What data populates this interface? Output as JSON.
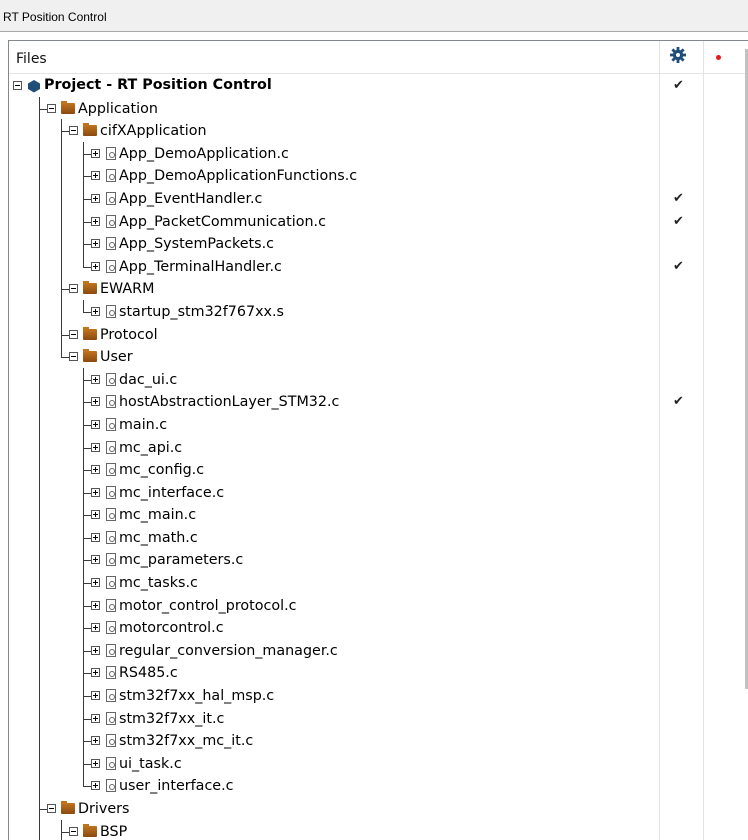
{
  "window": {
    "title": "RT Position Control"
  },
  "header": {
    "files_label": "Files",
    "col_icons": [
      "gear-icon",
      "red-dot-icon"
    ]
  },
  "check_glyph": "✔",
  "tree": [
    {
      "label": "Project - RT Position Control",
      "type": "project",
      "depth": 0,
      "checked": true
    },
    {
      "label": "Application",
      "type": "folder",
      "depth": 1,
      "checked": false
    },
    {
      "label": "cifXApplication",
      "type": "folder",
      "depth": 2,
      "checked": false
    },
    {
      "label": "App_DemoApplication.c",
      "type": "file",
      "depth": 3,
      "checked": false
    },
    {
      "label": "App_DemoApplicationFunctions.c",
      "type": "file",
      "depth": 3,
      "checked": false
    },
    {
      "label": "App_EventHandler.c",
      "type": "file",
      "depth": 3,
      "checked": true
    },
    {
      "label": "App_PacketCommunication.c",
      "type": "file",
      "depth": 3,
      "checked": true
    },
    {
      "label": "App_SystemPackets.c",
      "type": "file",
      "depth": 3,
      "checked": false
    },
    {
      "label": "App_TerminalHandler.c",
      "type": "file",
      "depth": 3,
      "checked": true
    },
    {
      "label": "EWARM",
      "type": "folder",
      "depth": 2,
      "checked": false
    },
    {
      "label": "startup_stm32f767xx.s",
      "type": "file",
      "depth": 3,
      "checked": false
    },
    {
      "label": "Protocol",
      "type": "folder",
      "depth": 2,
      "checked": false
    },
    {
      "label": "User",
      "type": "folder",
      "depth": 2,
      "checked": false
    },
    {
      "label": "dac_ui.c",
      "type": "file",
      "depth": 3,
      "checked": false
    },
    {
      "label": "hostAbstractionLayer_STM32.c",
      "type": "file",
      "depth": 3,
      "checked": true
    },
    {
      "label": "main.c",
      "type": "file",
      "depth": 3,
      "checked": false
    },
    {
      "label": "mc_api.c",
      "type": "file",
      "depth": 3,
      "checked": false
    },
    {
      "label": "mc_config.c",
      "type": "file",
      "depth": 3,
      "checked": false
    },
    {
      "label": "mc_interface.c",
      "type": "file",
      "depth": 3,
      "checked": false
    },
    {
      "label": "mc_main.c",
      "type": "file",
      "depth": 3,
      "checked": false
    },
    {
      "label": "mc_math.c",
      "type": "file",
      "depth": 3,
      "checked": false
    },
    {
      "label": "mc_parameters.c",
      "type": "file",
      "depth": 3,
      "checked": false
    },
    {
      "label": "mc_tasks.c",
      "type": "file",
      "depth": 3,
      "checked": false
    },
    {
      "label": "motor_control_protocol.c",
      "type": "file",
      "depth": 3,
      "checked": false
    },
    {
      "label": "motorcontrol.c",
      "type": "file",
      "depth": 3,
      "checked": false
    },
    {
      "label": "regular_conversion_manager.c",
      "type": "file",
      "depth": 3,
      "checked": false
    },
    {
      "label": "RS485.c",
      "type": "file",
      "depth": 3,
      "checked": false
    },
    {
      "label": "stm32f7xx_hal_msp.c",
      "type": "file",
      "depth": 3,
      "checked": false
    },
    {
      "label": "stm32f7xx_it.c",
      "type": "file",
      "depth": 3,
      "checked": false
    },
    {
      "label": "stm32f7xx_mc_it.c",
      "type": "file",
      "depth": 3,
      "checked": false
    },
    {
      "label": "ui_task.c",
      "type": "file",
      "depth": 3,
      "checked": false
    },
    {
      "label": "user_interface.c",
      "type": "file",
      "depth": 3,
      "checked": false
    },
    {
      "label": "Drivers",
      "type": "folder",
      "depth": 1,
      "checked": false
    },
    {
      "label": "BSP",
      "type": "folder",
      "depth": 2,
      "checked": false
    }
  ],
  "colors": {
    "folder": "#b0631a",
    "project": "#1f4e79",
    "red_dot": "#e8191b"
  }
}
